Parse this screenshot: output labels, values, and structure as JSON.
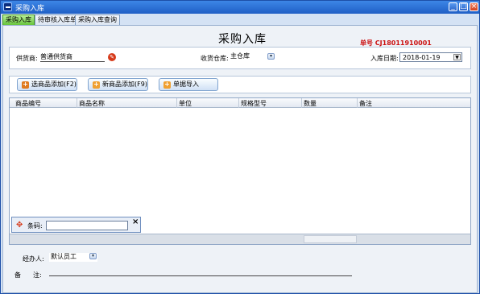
{
  "window": {
    "title": "采购入库",
    "minimize": "_",
    "maximize": "□",
    "close": "×"
  },
  "tabs": [
    {
      "label": "采购入库",
      "active": true
    },
    {
      "label": "待审核入库单",
      "active": false
    },
    {
      "label": "采购入库查询",
      "active": false
    }
  ],
  "form": {
    "title": "采购入库",
    "order_label": "单号",
    "order_number": "CJ18011910001"
  },
  "header": {
    "supplier_label": "供货商:",
    "supplier_value": "普通供货商",
    "warehouse_label": "收货仓库:",
    "warehouse_value": "主仓库",
    "date_label": "入库日期:",
    "date_value": "2018-01-19"
  },
  "toolbar": {
    "select_add": "选商品添加(F2)",
    "new_add": "新商品添加(F9)",
    "import": "单据导入"
  },
  "grid": {
    "columns": [
      "商品编号",
      "商品名称",
      "单位",
      "规格型号",
      "数量",
      "备注"
    ],
    "rows": []
  },
  "barcode": {
    "label": "条码:",
    "value": ""
  },
  "footer": {
    "handler_label": "经办人:",
    "handler_value": "默认员工",
    "remark_label_1": "备",
    "remark_label_2": "注:",
    "remark_value": ""
  },
  "colors": {
    "order_number": "#cc1111",
    "active_tab": "#67c43a",
    "titlebar": "#1f5fc6"
  }
}
